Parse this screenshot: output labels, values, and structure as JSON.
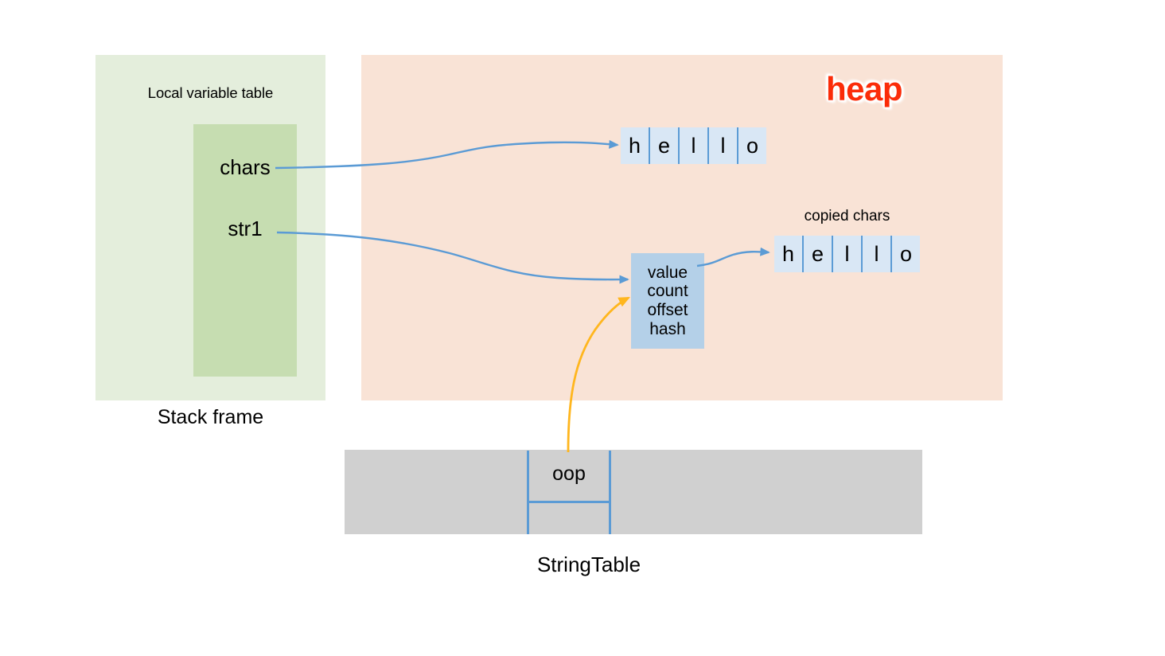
{
  "diagram": {
    "stack": {
      "region_label": "Stack frame",
      "lvt_label": "Local variable table",
      "variables": [
        {
          "name": "chars"
        },
        {
          "name": "str1"
        }
      ]
    },
    "heap": {
      "label": "heap",
      "label_color": "#fb2c09",
      "background": "#f9e3d6",
      "original_array": {
        "cells": [
          "h",
          "e",
          "l",
          "l",
          "o"
        ]
      },
      "copied_array": {
        "caption": "copied chars",
        "cells": [
          "h",
          "e",
          "l",
          "l",
          "o"
        ]
      },
      "string_object": {
        "fields": [
          "value",
          "count",
          "offset",
          "hash"
        ],
        "background": "#b4d0e8"
      }
    },
    "string_table": {
      "label": "StringTable",
      "cell_label": "oop",
      "background": "#d0d0d0",
      "border_color": "#5b9bd5"
    },
    "arrows": [
      {
        "name": "chars-to-original-array",
        "color": "#5b9bd5"
      },
      {
        "name": "str1-to-string-object",
        "color": "#5b9bd5"
      },
      {
        "name": "value-to-copied-array",
        "color": "#5b9bd5"
      },
      {
        "name": "stringtable-oop-to-string-object",
        "color": "#ffb61e"
      }
    ]
  }
}
